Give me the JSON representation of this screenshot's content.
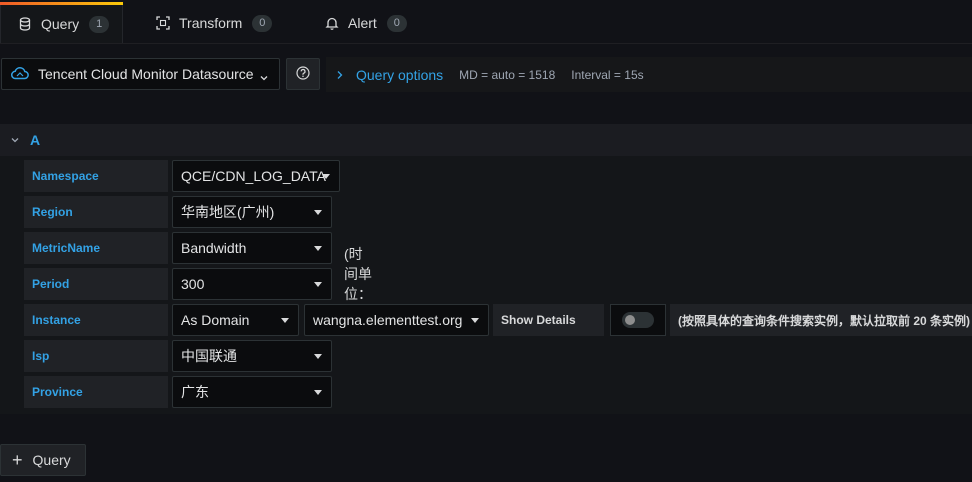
{
  "tabs": [
    {
      "label": "Query",
      "count": "1",
      "icon": "database-icon",
      "active": true
    },
    {
      "label": "Transform",
      "count": "0",
      "icon": "transform-icon",
      "active": false
    },
    {
      "label": "Alert",
      "count": "0",
      "icon": "bell-icon",
      "active": false
    }
  ],
  "datasource": {
    "name": "Tencent Cloud Monitor Datasource",
    "icon": "cloud-icon"
  },
  "query_options": {
    "title": "Query options",
    "md": "MD = auto = 1518",
    "interval": "Interval = 15s"
  },
  "query_row": {
    "name": "A"
  },
  "fields": {
    "namespace": {
      "label": "Namespace",
      "value": "QCE/CDN_LOG_DATA"
    },
    "region": {
      "label": "Region",
      "value": "华南地区(广州)"
    },
    "metric": {
      "label": "MetricName",
      "value": "Bandwidth"
    },
    "period": {
      "label": "Period",
      "value": "300",
      "note": "(时间单位：秒)"
    },
    "instance": {
      "label": "Instance",
      "mode": "As Domain",
      "value": "wangna.elementtest.org",
      "show_details_label": "Show Details",
      "show_details_on": false,
      "note": "(按照具体的查询条件搜索实例，默认拉取前 20 条实例)"
    },
    "isp": {
      "label": "Isp",
      "value": "中国联通"
    },
    "province": {
      "label": "Province",
      "value": "广东"
    }
  },
  "add_query": {
    "label": "Query"
  },
  "colors": {
    "accent": "#33a2e5",
    "background": "#111217",
    "panel": "#141619"
  }
}
